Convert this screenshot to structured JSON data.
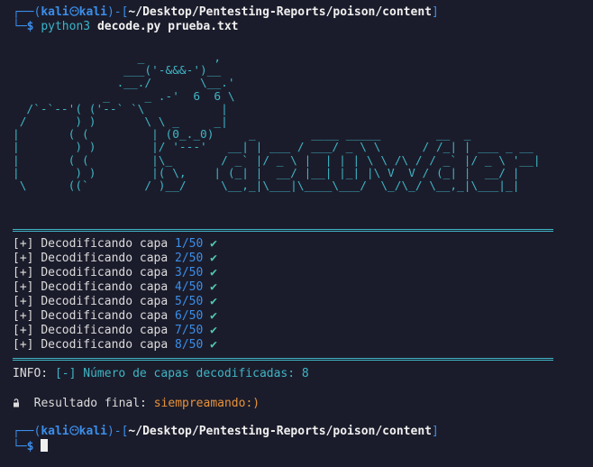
{
  "prompt1": {
    "corner_top": "┌──(",
    "user": "kali",
    "host": "kali",
    "mid": ")-[",
    "path": "~/Desktop/Pentesting-Reports/poison/content",
    "end": "]",
    "corner_bottom": "└─",
    "dollar": "$",
    "command": "python3",
    "args": "decode.py prueba.txt"
  },
  "banner": {
    "art": "                  _          ,\n                ___('-&&&-')__\n               .__./       \\__.'\n             _     _ .-'  6  6 \\\n  /`-`--'( ('--` `\\           |\n /       ) )       \\ \\ _     _|\n|       ( (         | (0_._0)     _        ____ _____        __  _\n|        ) )        |/ '---'   __| | ___ / ___/ _ \\ \\      / /_| | ___ _ __\n|       ( (         |\\_       / _` |/ _ \\ |  | | | \\ \\ /\\ / / _` |/ _ \\ '__|\n|        ) )        |( \\,    | (_| |  __/ |__| |_| |\\ V  V / (_| |  __/ |\n \\      ((`        / )__/     \\__,_|\\___|\\____\\___/  \\_/\\_/ \\__,_|\\___|_|"
  },
  "log": {
    "prefix": "[+]",
    "label": "Decodificando capa",
    "check": "✔",
    "steps": [
      "1/50",
      "2/50",
      "3/50",
      "4/50",
      "5/50",
      "6/50",
      "7/50",
      "8/50"
    ]
  },
  "info": {
    "prefix": "INFO:",
    "bracket": "[-]",
    "text": "Número de capas decodificadas:",
    "count": "8"
  },
  "result": {
    "label": "Resultado final:",
    "value": "siempreamando:)"
  },
  "prompt2": {
    "corner_top": "┌──(",
    "user": "kali",
    "host": "kali",
    "mid": ")-[",
    "path": "~/Desktop/Pentesting-Reports/poison/content",
    "end": "]",
    "corner_bottom": "└─",
    "dollar": "$"
  },
  "colors": {
    "background": "#1b1c2b",
    "prompt_blue": "#3b8eea",
    "banner_teal": "#3fb5c5",
    "result_orange": "#e8923a"
  }
}
